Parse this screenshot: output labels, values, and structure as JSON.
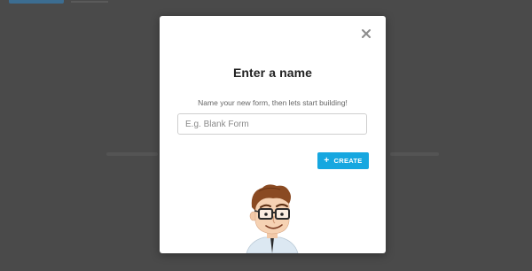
{
  "modal": {
    "title": "Enter a name",
    "subtitle": "Name your new form, then lets start building!",
    "input": {
      "placeholder": "E.g. Blank Form",
      "value": ""
    },
    "create_button": {
      "label": "CREATE",
      "icon": "plus-icon"
    },
    "close_icon": "close-icon",
    "mascot_icon": "mascot-character"
  },
  "colors": {
    "backdrop": "#4a4a4a",
    "accent": "#16a7e0",
    "modal_bg": "#ffffff"
  }
}
